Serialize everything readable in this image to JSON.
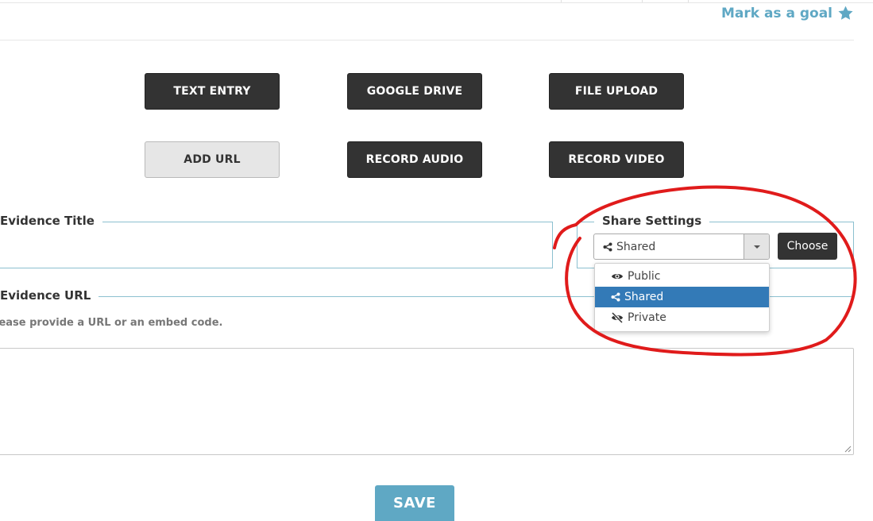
{
  "header": {
    "goal_label": "Mark as a goal",
    "goal_icon": "star-icon"
  },
  "entry_buttons": {
    "text_entry": "TEXT ENTRY",
    "google_drive": "GOOGLE DRIVE",
    "file_upload": "FILE UPLOAD",
    "add_url": "ADD URL",
    "record_audio": "RECORD AUDIO",
    "record_video": "RECORD VIDEO"
  },
  "evidence_title": {
    "label": "Evidence Title",
    "value": ""
  },
  "share_settings": {
    "label": "Share Settings",
    "selected": "Shared",
    "choose_label": "Choose",
    "options": [
      {
        "label": "Public",
        "icon": "eye-icon"
      },
      {
        "label": "Shared",
        "icon": "share-icon",
        "active": true
      },
      {
        "label": "Private",
        "icon": "eye-slash-icon"
      }
    ]
  },
  "evidence_url": {
    "label": "Evidence URL",
    "help": "lease provide a URL or an embed code.",
    "value": ""
  },
  "save_label": "SAVE",
  "colors": {
    "accent": "#5fa8c4",
    "dark_button": "#333333",
    "highlight": "#337ab7",
    "annotation": "#e01b1b"
  }
}
